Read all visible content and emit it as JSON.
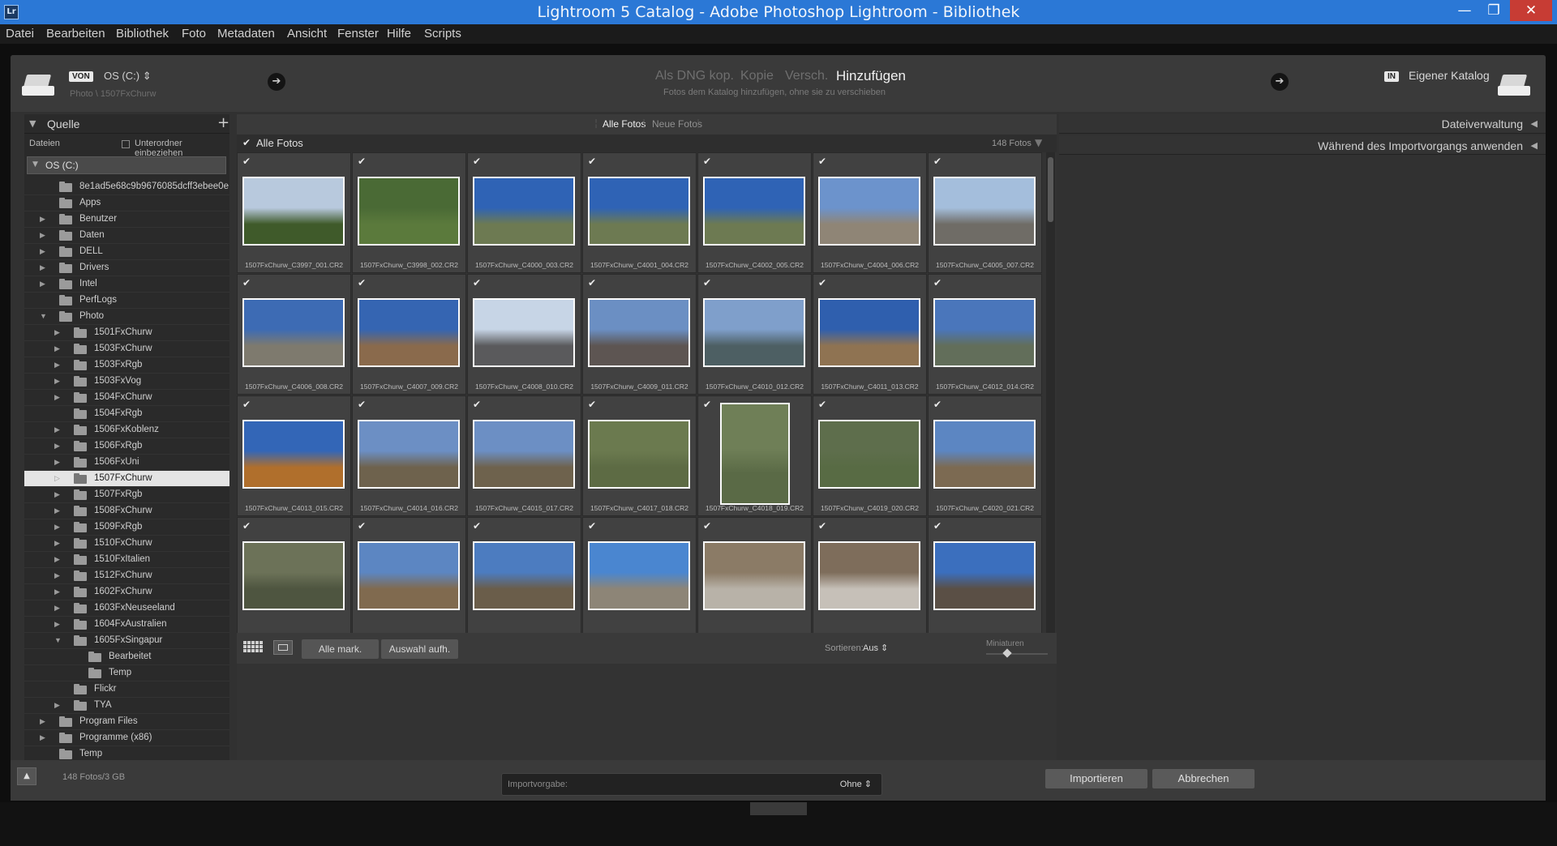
{
  "window": {
    "title": "Lightroom 5 Catalog - Adobe Photoshop Lightroom - Bibliothek",
    "app_icon": "Lr",
    "min": "—",
    "max": "❐",
    "close": "✕"
  },
  "menu": [
    "Datei",
    "Bearbeiten",
    "Bibliothek",
    "Foto",
    "Metadaten",
    "Ansicht",
    "Fenster",
    "Hilfe",
    "Scripts"
  ],
  "header": {
    "from_badge": "VON",
    "from_source": "OS (C:)",
    "from_path": "Photo \\ 1507FxChurw",
    "modes": [
      "Als DNG kop.",
      "Kopie",
      "Versch.",
      "Hinzufügen"
    ],
    "active_mode": "Hinzufügen",
    "mode_subtitle": "Fotos dem Katalog hinzufügen, ohne sie zu verschieben",
    "to_badge": "IN",
    "to_target": "Eigener Katalog"
  },
  "source_panel": {
    "title": "Quelle",
    "add": "+",
    "files_label": "Dateien",
    "include_subfolders": "Unterordner einbeziehen",
    "drive": "OS (C:)",
    "tree": [
      {
        "label": "8e1ad5e68c9b9676085dcff3ebee0e",
        "level": 0,
        "expander": ""
      },
      {
        "label": "Apps",
        "level": 0,
        "expander": ""
      },
      {
        "label": "Benutzer",
        "level": 0,
        "expander": "▶"
      },
      {
        "label": "Daten",
        "level": 0,
        "expander": "▶"
      },
      {
        "label": "DELL",
        "level": 0,
        "expander": "▶"
      },
      {
        "label": "Drivers",
        "level": 0,
        "expander": "▶"
      },
      {
        "label": "Intel",
        "level": 0,
        "expander": "▶"
      },
      {
        "label": "PerfLogs",
        "level": 0,
        "expander": ""
      },
      {
        "label": "Photo",
        "level": 0,
        "expander": "▼"
      },
      {
        "label": "1501FxChurw",
        "level": 1,
        "expander": "▶"
      },
      {
        "label": "1503FxChurw",
        "level": 1,
        "expander": "▶"
      },
      {
        "label": "1503FxRgb",
        "level": 1,
        "expander": "▶"
      },
      {
        "label": "1503FxVog",
        "level": 1,
        "expander": "▶"
      },
      {
        "label": "1504FxChurw",
        "level": 1,
        "expander": "▶"
      },
      {
        "label": "1504FxRgb",
        "level": 1,
        "expander": ""
      },
      {
        "label": "1506FxKoblenz",
        "level": 1,
        "expander": "▶"
      },
      {
        "label": "1506FxRgb",
        "level": 1,
        "expander": "▶"
      },
      {
        "label": "1506FxUni",
        "level": 1,
        "expander": "▶"
      },
      {
        "label": "1507FxChurw",
        "level": 1,
        "expander": "▷",
        "selected": true
      },
      {
        "label": "1507FxRgb",
        "level": 1,
        "expander": "▶"
      },
      {
        "label": "1508FxChurw",
        "level": 1,
        "expander": "▶"
      },
      {
        "label": "1509FxRgb",
        "level": 1,
        "expander": "▶"
      },
      {
        "label": "1510FxChurw",
        "level": 1,
        "expander": "▶"
      },
      {
        "label": "1510FxItalien",
        "level": 1,
        "expander": "▶"
      },
      {
        "label": "1512FxChurw",
        "level": 1,
        "expander": "▶"
      },
      {
        "label": "1602FxChurw",
        "level": 1,
        "expander": "▶"
      },
      {
        "label": "1603FxNeuseeland",
        "level": 1,
        "expander": "▶"
      },
      {
        "label": "1604FxAustralien",
        "level": 1,
        "expander": "▶"
      },
      {
        "label": "1605FxSingapur",
        "level": 1,
        "expander": "▼"
      },
      {
        "label": "Bearbeitet",
        "level": 2,
        "expander": ""
      },
      {
        "label": "Temp",
        "level": 2,
        "expander": ""
      },
      {
        "label": "Flickr",
        "level": 1,
        "expander": ""
      },
      {
        "label": "TYA",
        "level": 1,
        "expander": "▶"
      },
      {
        "label": "Program Files",
        "level": 0,
        "expander": "▶"
      },
      {
        "label": "Programme (x86)",
        "level": 0,
        "expander": "▶"
      },
      {
        "label": "Temp",
        "level": 0,
        "expander": ""
      }
    ]
  },
  "grid": {
    "tab_all": "Alle Fotos",
    "tab_new": "Neue Fotos",
    "all_photos_label": "Alle Fotos",
    "count": "148 Fotos",
    "check": "✔",
    "photos": [
      {
        "name": "1507FxChurw_C3997_001.CR2",
        "sky": "#b8c9dd",
        "ground": "#3f5a2a",
        "orient": "landscape"
      },
      {
        "name": "1507FxChurw_C3998_002.CR2",
        "sky": "#4a6a35",
        "ground": "#5b7a3c",
        "orient": "landscape"
      },
      {
        "name": "1507FxChurw_C4000_003.CR2",
        "sky": "#2f63b5",
        "ground": "#6d7a52",
        "orient": "landscape"
      },
      {
        "name": "1507FxChurw_C4001_004.CR2",
        "sky": "#2f63b5",
        "ground": "#6d7a52",
        "orient": "landscape"
      },
      {
        "name": "1507FxChurw_C4002_005.CR2",
        "sky": "#2f63b5",
        "ground": "#6d7a52",
        "orient": "landscape"
      },
      {
        "name": "1507FxChurw_C4004_006.CR2",
        "sky": "#6c93cc",
        "ground": "#8f8576",
        "orient": "landscape"
      },
      {
        "name": "1507FxChurw_C4005_007.CR2",
        "sky": "#a4bedc",
        "ground": "#6f6c66",
        "orient": "landscape"
      },
      {
        "name": "1507FxChurw_C4006_008.CR2",
        "sky": "#3d6bb4",
        "ground": "#7e7a6e",
        "orient": "landscape"
      },
      {
        "name": "1507FxChurw_C4007_009.CR2",
        "sky": "#3565b2",
        "ground": "#8a6a4c",
        "orient": "landscape"
      },
      {
        "name": "1507FxChurw_C4008_010.CR2",
        "sky": "#c7d5e6",
        "ground": "#5a5a5c",
        "orient": "landscape"
      },
      {
        "name": "1507FxChurw_C4009_011.CR2",
        "sky": "#6b8fc3",
        "ground": "#5d5552",
        "orient": "landscape"
      },
      {
        "name": "1507FxChurw_C4010_012.CR2",
        "sky": "#7f9fcb",
        "ground": "#4d5f63",
        "orient": "landscape"
      },
      {
        "name": "1507FxChurw_C4011_013.CR2",
        "sky": "#2f5fae",
        "ground": "#8f7352",
        "orient": "landscape"
      },
      {
        "name": "1507FxChurw_C4012_014.CR2",
        "sky": "#4a76bb",
        "ground": "#626e5a",
        "orient": "landscape"
      },
      {
        "name": "1507FxChurw_C4013_015.CR2",
        "sky": "#3366b7",
        "ground": "#b06f2c",
        "orient": "landscape"
      },
      {
        "name": "1507FxChurw_C4014_016.CR2",
        "sky": "#6c8fc4",
        "ground": "#6e624d",
        "orient": "landscape"
      },
      {
        "name": "1507FxChurw_C4015_017.CR2",
        "sky": "#6c8fc4",
        "ground": "#6e624d",
        "orient": "landscape"
      },
      {
        "name": "1507FxChurw_C4017_018.CR2",
        "sky": "#6b7a4f",
        "ground": "#5d6b44",
        "orient": "landscape"
      },
      {
        "name": "1507FxChurw_C4018_019.CR2",
        "sky": "#6f7f57",
        "ground": "#5a6a46",
        "orient": "portrait"
      },
      {
        "name": "1507FxChurw_C4019_020.CR2",
        "sky": "#5e6e4c",
        "ground": "#586b44",
        "orient": "landscape"
      },
      {
        "name": "1507FxChurw_C4020_021.CR2",
        "sky": "#5c86c2",
        "ground": "#7c6a52",
        "orient": "landscape"
      },
      {
        "name": "",
        "sky": "#6c7258",
        "ground": "#4e5540",
        "orient": "landscape"
      },
      {
        "name": "",
        "sky": "#5c86c2",
        "ground": "#806a4f",
        "orient": "landscape"
      },
      {
        "name": "",
        "sky": "#4c7cc0",
        "ground": "#6a5d4a",
        "orient": "landscape"
      },
      {
        "name": "",
        "sky": "#4a86d0",
        "ground": "#8d8577",
        "orient": "landscape"
      },
      {
        "name": "",
        "sky": "#8b7b66",
        "ground": "#b8b2a8",
        "orient": "landscape"
      },
      {
        "name": "",
        "sky": "#7e6d5b",
        "ground": "#c6c0b8",
        "orient": "landscape"
      },
      {
        "name": "",
        "sky": "#3b6fbe",
        "ground": "#5a4f45",
        "orient": "landscape"
      }
    ],
    "select_all": "Alle mark.",
    "deselect": "Auswahl aufh.",
    "sort_label": "Sortieren:",
    "sort_value": "Aus",
    "thumb_label": "Miniaturen"
  },
  "right_panel": {
    "file_handling": "Dateiverwaltung",
    "apply_during_import": "Während des Importvorgangs anwenden"
  },
  "footer": {
    "stats": "148 Fotos/3 GB",
    "preset_label": "Importvorgabe:",
    "preset_value": "Ohne",
    "import": "Importieren",
    "cancel": "Abbrechen"
  }
}
